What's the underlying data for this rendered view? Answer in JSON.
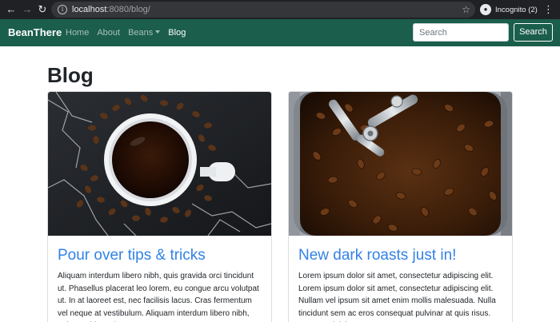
{
  "browser": {
    "url_host": "localhost",
    "url_rest": ":8080/blog/",
    "profile_label": "Incognito (2)",
    "icons": [
      "back-arrow-icon",
      "forward-arrow-icon",
      "reload-icon",
      "info-icon",
      "star-icon",
      "incognito-icon",
      "kebab-menu-icon"
    ]
  },
  "navbar": {
    "brand": "BeanThere",
    "links": [
      {
        "label": "Home"
      },
      {
        "label": "About"
      },
      {
        "label": "Beans"
      },
      {
        "label": "Blog"
      }
    ],
    "search_placeholder": "Search",
    "search_button": "Search",
    "background_color": "#1b5e4b"
  },
  "page": {
    "title": "Blog"
  },
  "posts": [
    {
      "title": "Pour over tips & tricks",
      "excerpt": "Aliquam interdum libero nibh, quis gravida orci tincidunt ut. Phasellus placerat leo lorem, eu congue arcu volutpat ut. In at laoreet est, nec facilisis lacus. Cras fermentum vel neque at vestibulum. Aliquam interdum libero nibh, quis gravida orci"
    },
    {
      "title": "New dark roasts just in!",
      "excerpt": "Lorem ipsum dolor sit amet, consectetur adipiscing elit. Lorem ipsum dolor sit amet, consectetur adipiscing elit. Nullam vel ipsum sit amet enim mollis malesuada. Nulla tincidunt sem ac eros consequat pulvinar at quis risus. Aenean ultricies"
    }
  ],
  "colors": {
    "link_blue": "#3282e6",
    "text_dark": "#212529"
  }
}
